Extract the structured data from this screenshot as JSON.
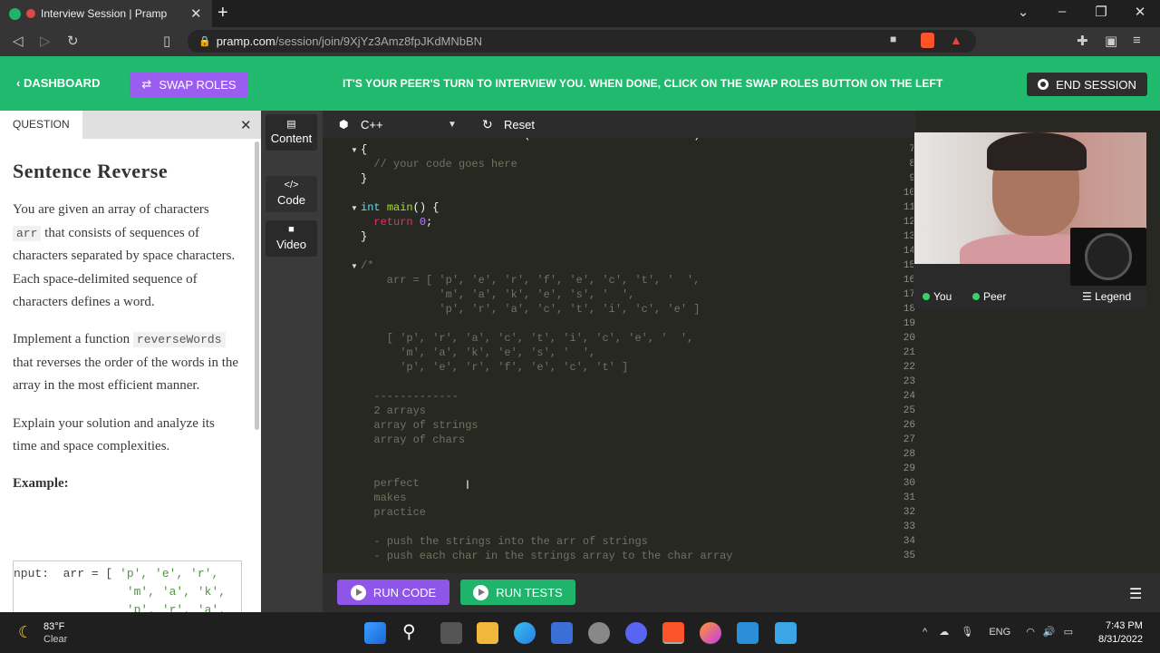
{
  "browser": {
    "tab_title": "Interview Session | Pramp",
    "url_host": "pramp.com",
    "url_path": "/session/join/9XjYz3Amz8fpJKdMNbBN"
  },
  "header": {
    "dashboard_label": "DASHBOARD",
    "swap_label": "SWAP ROLES",
    "notice": "IT'S YOUR PEER'S TURN TO INTERVIEW YOU. WHEN DONE, CLICK ON THE SWAP ROLES BUTTON ON THE LEFT",
    "end_label": "END SESSION"
  },
  "question": {
    "tab_label": "QUESTION",
    "title": "Sentence Reverse",
    "p1_a": "You are given an array of characters",
    "p1_code": "arr",
    "p1_b": "that consists of sequences of characters separated by space characters. Each space-delimited sequence of characters defines a word.",
    "p2_a": "Implement a function",
    "p2_code": "reverseWords",
    "p2_b": "that reverses the order of the words in the array in the most efficient manner.",
    "p3": "Explain your solution and analyze its time and space complexities.",
    "example_label": "Example:",
    "example_line1_a": "nput:  arr = [ ",
    "example_line1_s": "'p', 'e', 'r',",
    "example_line2_s": "'m', 'a', 'k',",
    "example_line3_s": "'p', 'r', 'a',"
  },
  "sidebar": {
    "content_label": "Content",
    "code_label": "Code",
    "video_label": "Video"
  },
  "editor": {
    "language": "C++",
    "reset_label": "Reset",
    "run_code_label": "RUN CODE",
    "run_tests_label": "RUN TESTS",
    "lines": [
      {
        "n": "6",
        "t": "vector<char> reverseWords( const vector<char>& arr )"
      },
      {
        "n": "7",
        "t": "{"
      },
      {
        "n": "8",
        "t": "  // your code goes here"
      },
      {
        "n": "9",
        "t": "}"
      },
      {
        "n": "10",
        "t": ""
      },
      {
        "n": "11",
        "t": "int main() {"
      },
      {
        "n": "12",
        "t": "  return 0;"
      },
      {
        "n": "13",
        "t": "}"
      },
      {
        "n": "14",
        "t": ""
      },
      {
        "n": "15",
        "t": "/*"
      },
      {
        "n": "16",
        "t": "    arr = [ 'p', 'e', 'r', 'f', 'e', 'c', 't', '  ',"
      },
      {
        "n": "17",
        "t": "            'm', 'a', 'k', 'e', 's', '  ',"
      },
      {
        "n": "18",
        "t": "            'p', 'r', 'a', 'c', 't', 'i', 'c', 'e' ]"
      },
      {
        "n": "19",
        "t": ""
      },
      {
        "n": "20",
        "t": "    [ 'p', 'r', 'a', 'c', 't', 'i', 'c', 'e', '  ',"
      },
      {
        "n": "21",
        "t": "      'm', 'a', 'k', 'e', 's', '  ',"
      },
      {
        "n": "22",
        "t": "      'p', 'e', 'r', 'f', 'e', 'c', 't' ]"
      },
      {
        "n": "23",
        "t": ""
      },
      {
        "n": "24",
        "t": "  -------------"
      },
      {
        "n": "25",
        "t": "  2 arrays"
      },
      {
        "n": "26",
        "t": "  array of strings"
      },
      {
        "n": "27",
        "t": "  array of chars"
      },
      {
        "n": "28",
        "t": ""
      },
      {
        "n": "29",
        "t": ""
      },
      {
        "n": "30",
        "t": "  perfect"
      },
      {
        "n": "31",
        "t": "  makes"
      },
      {
        "n": "32",
        "t": "  practice"
      },
      {
        "n": "33",
        "t": ""
      },
      {
        "n": "34",
        "t": "  - push the strings into the arr of strings"
      },
      {
        "n": "35",
        "t": "  - push each char in the strings array to the char array"
      }
    ]
  },
  "video": {
    "you_label": "You",
    "peer_label": "Peer",
    "legend_label": "Legend"
  },
  "taskbar": {
    "temp": "83°F",
    "weather": "Clear",
    "lang": "ENG",
    "time": "7:43 PM",
    "date": "8/31/2022"
  },
  "colors": {
    "header_green": "#21b96e",
    "swap_purple": "#9b5cf0",
    "editor_bg": "#272822"
  }
}
